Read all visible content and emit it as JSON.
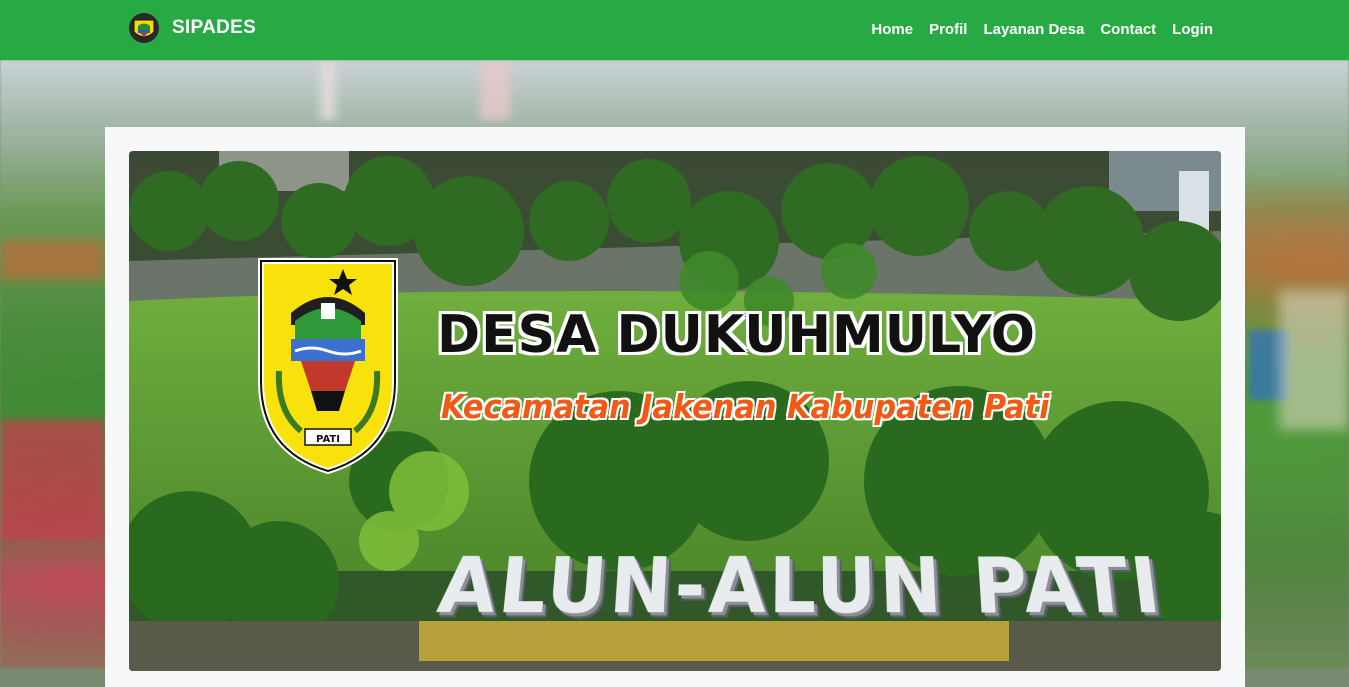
{
  "navbar": {
    "brand": "SIPADES",
    "brand_logo_icon": "pati-crest-icon",
    "links": [
      "Home",
      "Profil",
      "Layanan Desa",
      "Contact",
      "Login"
    ]
  },
  "hero": {
    "title": "DESA DUKUHMULYO",
    "subtitle": "Kecamatan Jakenan Kabupaten Pati",
    "landmark_sign": "ALUN-ALUN PATI",
    "crest_label": "PATI"
  },
  "colors": {
    "navbar": "#27aa44",
    "subtitle": "#f05a14",
    "card": "#f7f8fa"
  }
}
